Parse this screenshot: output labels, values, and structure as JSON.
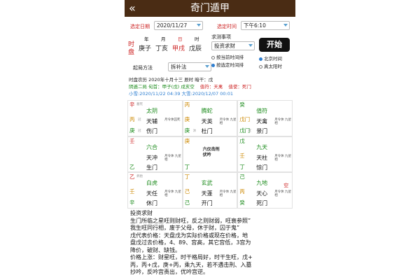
{
  "header": {
    "back_icon": "«",
    "title": "奇门遁甲"
  },
  "form": {
    "date_label": "选定日期",
    "date_value": "2020/11/27",
    "time_label": "选定时间",
    "time_value": "下午6:10",
    "pillar_headers": [
      "年",
      "月",
      "日",
      "时"
    ],
    "side_label": "时\n盘",
    "pillars": [
      "庚子",
      "丁亥",
      "甲戌",
      "戊辰"
    ],
    "event_label": "求测事项",
    "event_value": "投资求财",
    "start_label": "开始",
    "radio_current": "按当前时间排",
    "radio_selected": "按选定时间排",
    "method_label": "起局方法",
    "method_value": "拆补法",
    "tz_beijing": "北京时间",
    "tz_solar": "真太阳时"
  },
  "info": {
    "line1": "时盘农历 2020年十月十三 辰时  暗干：戊",
    "line2a": "阴遁二局 旬首：甲子(戊) 戌亥空",
    "line2b": "值符：天禽",
    "line2c": "值使：死门",
    "line3": "小雪:2020/11/22 04:39 大雪:2020/12/07 00:01"
  },
  "palaces": [
    {
      "tl": "辛",
      "ts": "墓死",
      "ml": "丙",
      "ms": "冠",
      "bl": "庚",
      "bs": "冠",
      "god": "太阴",
      "star": "天辅",
      "door": "伤门",
      "note": "月令休囚死"
    },
    {
      "tl": "丙",
      "ts": "",
      "ml": "庚",
      "ms": "",
      "bl": "庚",
      "bs": "沐",
      "god": "腾蛇",
      "star": "天英",
      "door": "杜门",
      "note": "月令休 九星相"
    },
    {
      "tl": "癸",
      "ts": "",
      "ml": "戊门",
      "ms": "",
      "bl": "戊门",
      "bs": "冠",
      "god": "值符",
      "star": "天禽",
      "door": "景门",
      "note": "月令休 九星相"
    },
    {
      "tl": "壬",
      "ts": "",
      "ml": "",
      "ms": "",
      "bl": "乙",
      "bs": "",
      "god": "六合",
      "star": "天冲",
      "door": "生门",
      "note": "月令休 九星相"
    },
    {
      "tl": "庚",
      "ts": "",
      "ml": "",
      "ms": "",
      "bl": "丁",
      "bs": "",
      "god": "",
      "star": "",
      "door": "",
      "note": ""
    },
    {
      "tl": "戊",
      "ts": "",
      "ml": "壬",
      "ms": "",
      "bl": "丁",
      "bs": "",
      "god": "九天",
      "star": "天柱",
      "door": "惊门",
      "note": "月令休 九星相"
    },
    {
      "tl": "乙",
      "ts": "养胎",
      "ml": "壬",
      "ms": "",
      "bl": "辛",
      "bs": "",
      "god": "白虎",
      "star": "天任",
      "door": "休门",
      "note": "月令休 九星相"
    },
    {
      "tl": "丁",
      "ts": "",
      "ml": "己",
      "ms": "",
      "bl": "己",
      "bs": "",
      "god": "玄武",
      "star": "天蓬",
      "door": "开门",
      "note": "月令休 九星相"
    },
    {
      "tl": "己",
      "ts": "",
      "ml": "丙",
      "ms": "",
      "bl": "癸",
      "bs": "",
      "god": "九地",
      "star": "天心",
      "door": "死门",
      "note": "月令休 九星相"
    }
  ],
  "center_text": "六仪击刑\n伏吟",
  "kong": [
    "空",
    "空"
  ],
  "analysis": [
    "投资求财",
    "生门所临之星旺则财旺，反之则财弱，旺衰参照”",
    "我生旺同行相，废于父母，休于财，囚于鬼”",
    "戊代表价格：天盘戊为实际价格或现在价格，地",
    "盘戊过去价格，4、89、宫高，其它宫低，3宫为",
    "降价，破财、缺钱。",
    "价格上涨：财星旺，时干格局好，时干生旺，戊+",
    "丙，丙+戊，庚+丙，乘九天，若不遇击刑、入墓",
    "抄吟，反吟宫责出，优吟宫逆。"
  ],
  "colors": {
    "brand": "#4a2c14",
    "accent": "#2f7fd1",
    "red": "#cc2222",
    "green": "#1a8a1a"
  }
}
